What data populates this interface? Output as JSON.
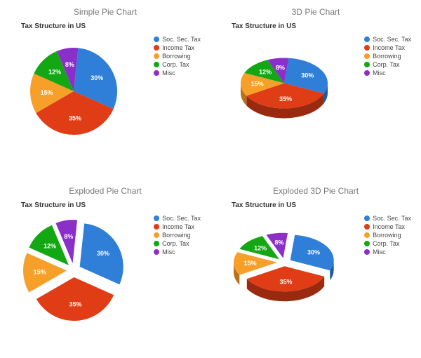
{
  "panels": [
    {
      "title": "Simple Pie Chart",
      "style": "flat",
      "exploded": false
    },
    {
      "title": "3D Pie Chart",
      "style": "three_d",
      "exploded": false
    },
    {
      "title": "Exploded Pie Chart",
      "style": "flat",
      "exploded": true
    },
    {
      "title": "Exploded 3D Pie Chart",
      "style": "three_d",
      "exploded": true
    }
  ],
  "chart_data": {
    "type": "pie",
    "title": "Tax Structure in US",
    "series": [
      {
        "name": "Soc. Sec. Tax",
        "value": 30,
        "label": "30%",
        "color": "#2f7ed8",
        "dark": "#1f5a9e"
      },
      {
        "name": "Income Tax",
        "value": 35,
        "label": "35%",
        "color": "#e03c15",
        "dark": "#9a2a0f"
      },
      {
        "name": "Borrowing",
        "value": 15,
        "label": "15%",
        "color": "#f7a029",
        "dark": "#b3721c"
      },
      {
        "name": "Corp. Tax",
        "value": 12,
        "label": "12%",
        "color": "#13a813",
        "dark": "#0d770d"
      },
      {
        "name": "Misc",
        "value": 8,
        "label": "8%",
        "color": "#8b2fc9",
        "dark": "#5e1f89"
      }
    ],
    "legend_position": "right"
  }
}
